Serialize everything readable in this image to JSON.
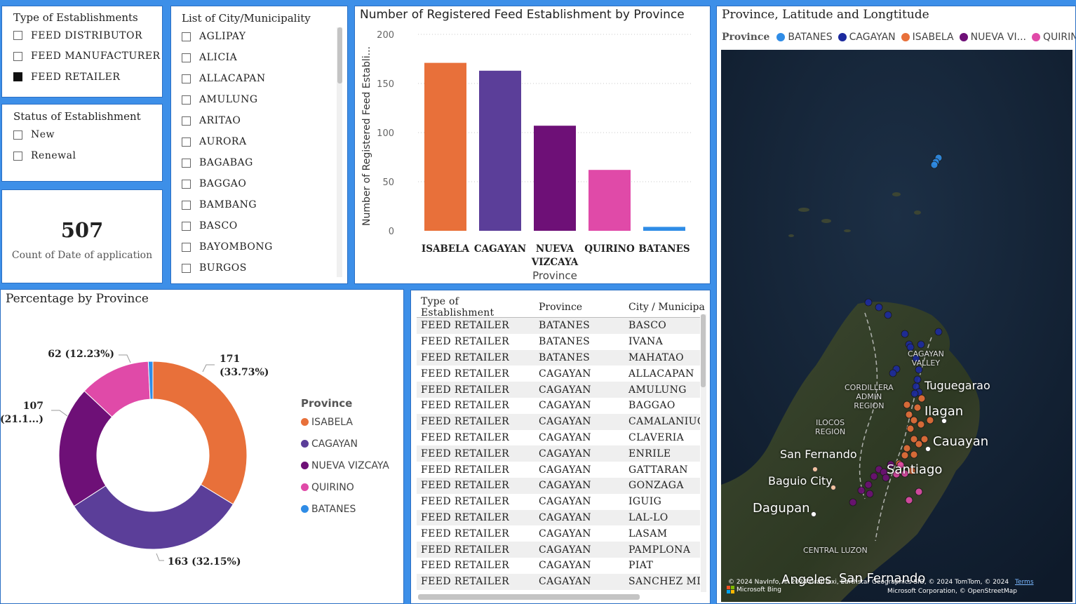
{
  "type_slicer": {
    "title": "Type of Establishments",
    "items": [
      {
        "label": "FEED DISTRIBUTOR",
        "checked": false
      },
      {
        "label": "FEED MANUFACTURER",
        "checked": false
      },
      {
        "label": "FEED RETAILER",
        "checked": true
      }
    ]
  },
  "status_slicer": {
    "title": "Status of Establishment",
    "items": [
      {
        "label": "New",
        "checked": false
      },
      {
        "label": "Renewal",
        "checked": false
      }
    ]
  },
  "card": {
    "value": "507",
    "label": "Count of Date of application"
  },
  "city_slicer": {
    "title": "List of City/Municipality",
    "items": [
      "AGLIPAY",
      "ALICIA",
      "ALLACAPAN",
      "AMULUNG",
      "ARITAO",
      "AURORA",
      "BAGABAG",
      "BAGGAO",
      "BAMBANG",
      "BASCO",
      "BAYOMBONG",
      "BURGOS"
    ]
  },
  "bar_chart": {
    "title": "Number of Registered Feed Establishment by Province",
    "ylabel_display": "Number of Registered Feed Establi...",
    "xlabel": "Province",
    "category_labels": [
      [
        "ISABELA"
      ],
      [
        "CAGAYAN"
      ],
      [
        "NUEVA",
        "VIZCAYA"
      ],
      [
        "QUIRINO"
      ],
      [
        "BATANES"
      ]
    ]
  },
  "chart_data": {
    "type": "bar",
    "title": "Number of Registered Feed Establishment by Province",
    "xlabel": "Province",
    "ylabel": "Number of Registered Feed Establi...",
    "categories": [
      "ISABELA",
      "CAGAYAN",
      "NUEVA VIZCAYA",
      "QUIRINO",
      "BATANES"
    ],
    "values": [
      171,
      163,
      107,
      62,
      4
    ],
    "colors": [
      "#e8703a",
      "#5b3e99",
      "#6e1077",
      "#e04aa8",
      "#2f8ce6"
    ],
    "ylim": [
      0,
      200
    ],
    "yticks": [
      0,
      50,
      100,
      150,
      200
    ],
    "grid": true
  },
  "donut": {
    "title": "Percentage by Province",
    "legend_title": "Province",
    "slices": [
      {
        "name": "ISABELA",
        "value": 171,
        "color": "#e8703a"
      },
      {
        "name": "CAGAYAN",
        "value": 163,
        "color": "#5b3e99"
      },
      {
        "name": "NUEVA VIZCAYA",
        "value": 107,
        "color": "#6e1077"
      },
      {
        "name": "QUIRINO",
        "value": 62,
        "color": "#e04aa8"
      },
      {
        "name": "BATANES",
        "value": 4,
        "color": "#2f8ce6"
      }
    ],
    "labels": {
      "isabela_line1": "171",
      "isabela_line2": "(33.73%)",
      "cagayan": "163 (32.15%)",
      "nueva_line1": "107",
      "nueva_line2": "(21.1...)",
      "quirino": "62 (12.23%)"
    }
  },
  "table": {
    "columns": [
      "Type of Establishment",
      "Province",
      "City / Municipa"
    ],
    "rows": [
      [
        "FEED RETAILER",
        "BATANES",
        "BASCO"
      ],
      [
        "FEED RETAILER",
        "BATANES",
        "IVANA"
      ],
      [
        "FEED RETAILER",
        "BATANES",
        "MAHATAO"
      ],
      [
        "FEED RETAILER",
        "CAGAYAN",
        "ALLACAPAN"
      ],
      [
        "FEED RETAILER",
        "CAGAYAN",
        "AMULUNG"
      ],
      [
        "FEED RETAILER",
        "CAGAYAN",
        "BAGGAO"
      ],
      [
        "FEED RETAILER",
        "CAGAYAN",
        "CAMALANIUGA"
      ],
      [
        "FEED RETAILER",
        "CAGAYAN",
        "CLAVERIA"
      ],
      [
        "FEED RETAILER",
        "CAGAYAN",
        "ENRILE"
      ],
      [
        "FEED RETAILER",
        "CAGAYAN",
        "GATTARAN"
      ],
      [
        "FEED RETAILER",
        "CAGAYAN",
        "GONZAGA"
      ],
      [
        "FEED RETAILER",
        "CAGAYAN",
        "IGUIG"
      ],
      [
        "FEED RETAILER",
        "CAGAYAN",
        "LAL-LO"
      ],
      [
        "FEED RETAILER",
        "CAGAYAN",
        "LASAM"
      ],
      [
        "FEED RETAILER",
        "CAGAYAN",
        "PAMPLONA"
      ],
      [
        "FEED RETAILER",
        "CAGAYAN",
        "PIAT"
      ],
      [
        "FEED RETAILER",
        "CAGAYAN",
        "SANCHEZ MIR"
      ]
    ]
  },
  "map": {
    "title": "Province, Latitude and Longtitude",
    "legend_title": "Province",
    "legend": [
      {
        "name": "BATANES",
        "color": "#2f8ce6"
      },
      {
        "name": "CAGAYAN",
        "color": "#1c2a9e"
      },
      {
        "name": "ISABELA",
        "color": "#e8703a"
      },
      {
        "name": "NUEVA VI...",
        "color": "#6e1077"
      },
      {
        "name": "QUIRIN",
        "color": "#e04aa8"
      }
    ],
    "labels": {
      "tuguegarao": "Tuguegarao",
      "ilagan": "Ilagan",
      "cauayan": "Cauayan",
      "santiago": "Santiago",
      "san_fernando": "San Fernando",
      "baguio": "Baguio City",
      "dagupan": "Dagupan",
      "angeles": "Angeles",
      "san_fernando2": "San Fernando",
      "cagayan_valley": "CAGAYAN\nVALLEY",
      "cordillera": "CORDILLERA\nADMIN\nREGION",
      "ilocos": "ILOCOS\nREGION",
      "central_luzon": "CENTRAL LUZON"
    },
    "attribution": "© 2024 NavInfo, © 2024 GrabTaxi, Earthstar Geographics SIO, © 2024 TomTom, © 2024",
    "attribution2": "Microsoft Corporation, © OpenStreetMap",
    "terms": "Terms",
    "bing": "Microsoft Bing"
  }
}
